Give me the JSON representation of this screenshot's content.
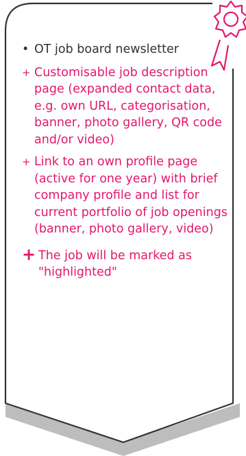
{
  "list": {
    "items": [
      {
        "marker": "•",
        "text": "OT job board newsletter"
      },
      {
        "marker": "+",
        "text": "Customisable job description page (expanded contact data, e.g. own URL, categorisation, banner, photo gallery, QR code and/or video)"
      },
      {
        "marker": "+",
        "text": "Link to an own profile page (active for one year) with brief company profile and list for current portfolio of job openings (banner, photo gallery, video)"
      },
      {
        "marker": "+",
        "text": "The job will be marked as \"highlighted\""
      }
    ]
  },
  "colors": {
    "accent": "#e2186b",
    "frame": "#333333",
    "shadow": "#bdbdbd"
  },
  "icons": {
    "badge": "award-rosette-icon"
  }
}
